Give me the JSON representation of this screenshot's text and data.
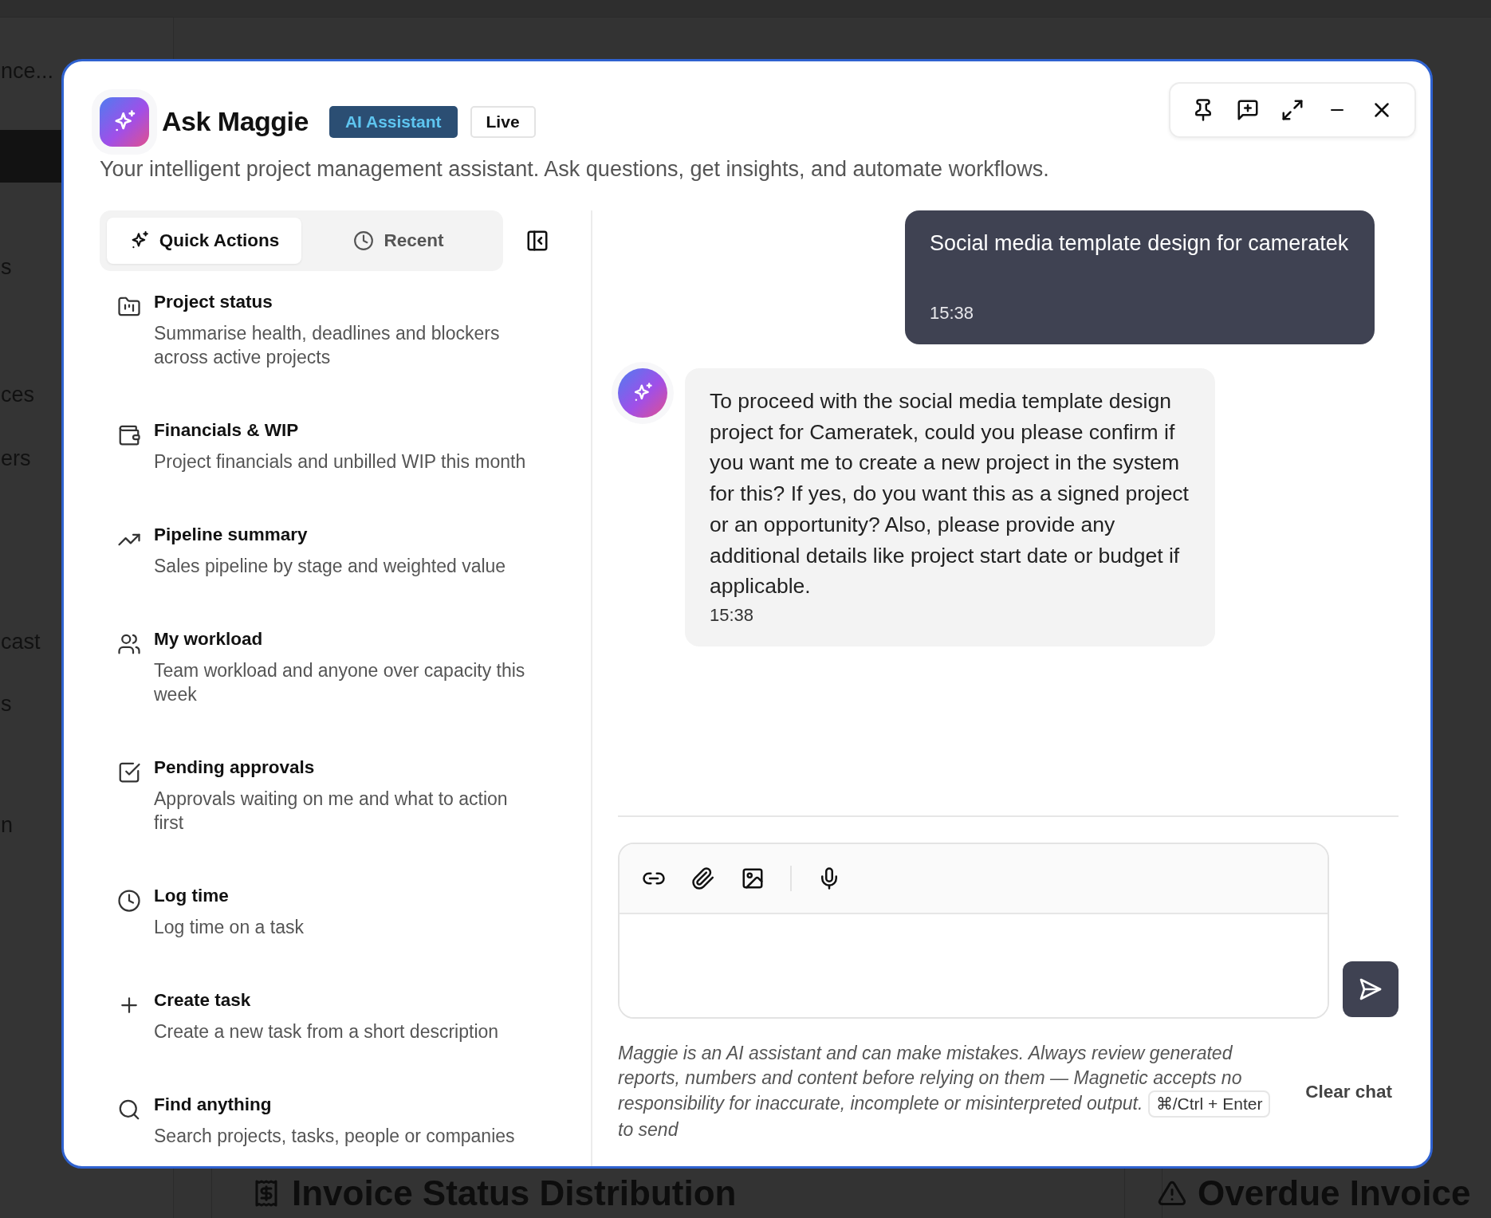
{
  "background_page": {
    "search_text": "nce...",
    "sidebar_labels": [
      "s",
      "ces",
      "ers",
      "cast",
      "s",
      "n"
    ],
    "panels": [
      {
        "kind": "receipt",
        "title": "Invoice Status Distribution"
      },
      {
        "kind": "warning",
        "title": "Overdue Invoice"
      }
    ]
  },
  "assistant": {
    "title": "Ask Maggie",
    "badges": [
      {
        "label": "AI Assistant",
        "kind": "primary"
      },
      {
        "label": "Live",
        "kind": "outline"
      }
    ],
    "subtitle": "Your intelligent project management assistant. Ask questions, get insights, and automate workflows.",
    "tabs": [
      {
        "label": "Quick Actions",
        "selected": true
      },
      {
        "label": "Recent",
        "selected": false
      }
    ],
    "quick_actions": [
      {
        "title": "Project status",
        "description": "Summarise health, deadlines and blockers across active projects"
      },
      {
        "title": "Financials & WIP",
        "description": "Project financials and unbilled WIP this month"
      },
      {
        "title": "Pipeline summary",
        "description": "Sales pipeline by stage and weighted value"
      },
      {
        "title": "My workload",
        "description": "Team workload and anyone over capacity this week"
      },
      {
        "title": "Pending approvals",
        "description": "Approvals waiting on me and what to action first"
      },
      {
        "title": "Log time",
        "description": "Log time on a task"
      },
      {
        "title": "Create task",
        "description": "Create a new task from a short description"
      },
      {
        "title": "Find anything",
        "description": "Search projects, tasks, people or companies"
      }
    ],
    "messages": [
      {
        "kind": "user",
        "text": "Social media template design for cameratek",
        "time": "15:38"
      },
      {
        "kind": "assistant",
        "text": "To proceed with the social media template design project for Cameratek, could you please confirm if you want me to create a new project in the system for this? If yes, do you want this as a signed project or an opportunity? Also, please provide any additional details like project start date or budget if applicable.",
        "time": "15:38"
      }
    ],
    "disclaimer": "Maggie is an AI assistant and can make mistakes. Always review generated reports, numbers and content before relying on them — Magnetic accepts no responsibility for inaccurate, incomplete or misinterpreted output.",
    "shortcut": "⌘/Ctrl + Enter",
    "shortcut_suffix": "to send",
    "clear_button": "Clear chat"
  }
}
